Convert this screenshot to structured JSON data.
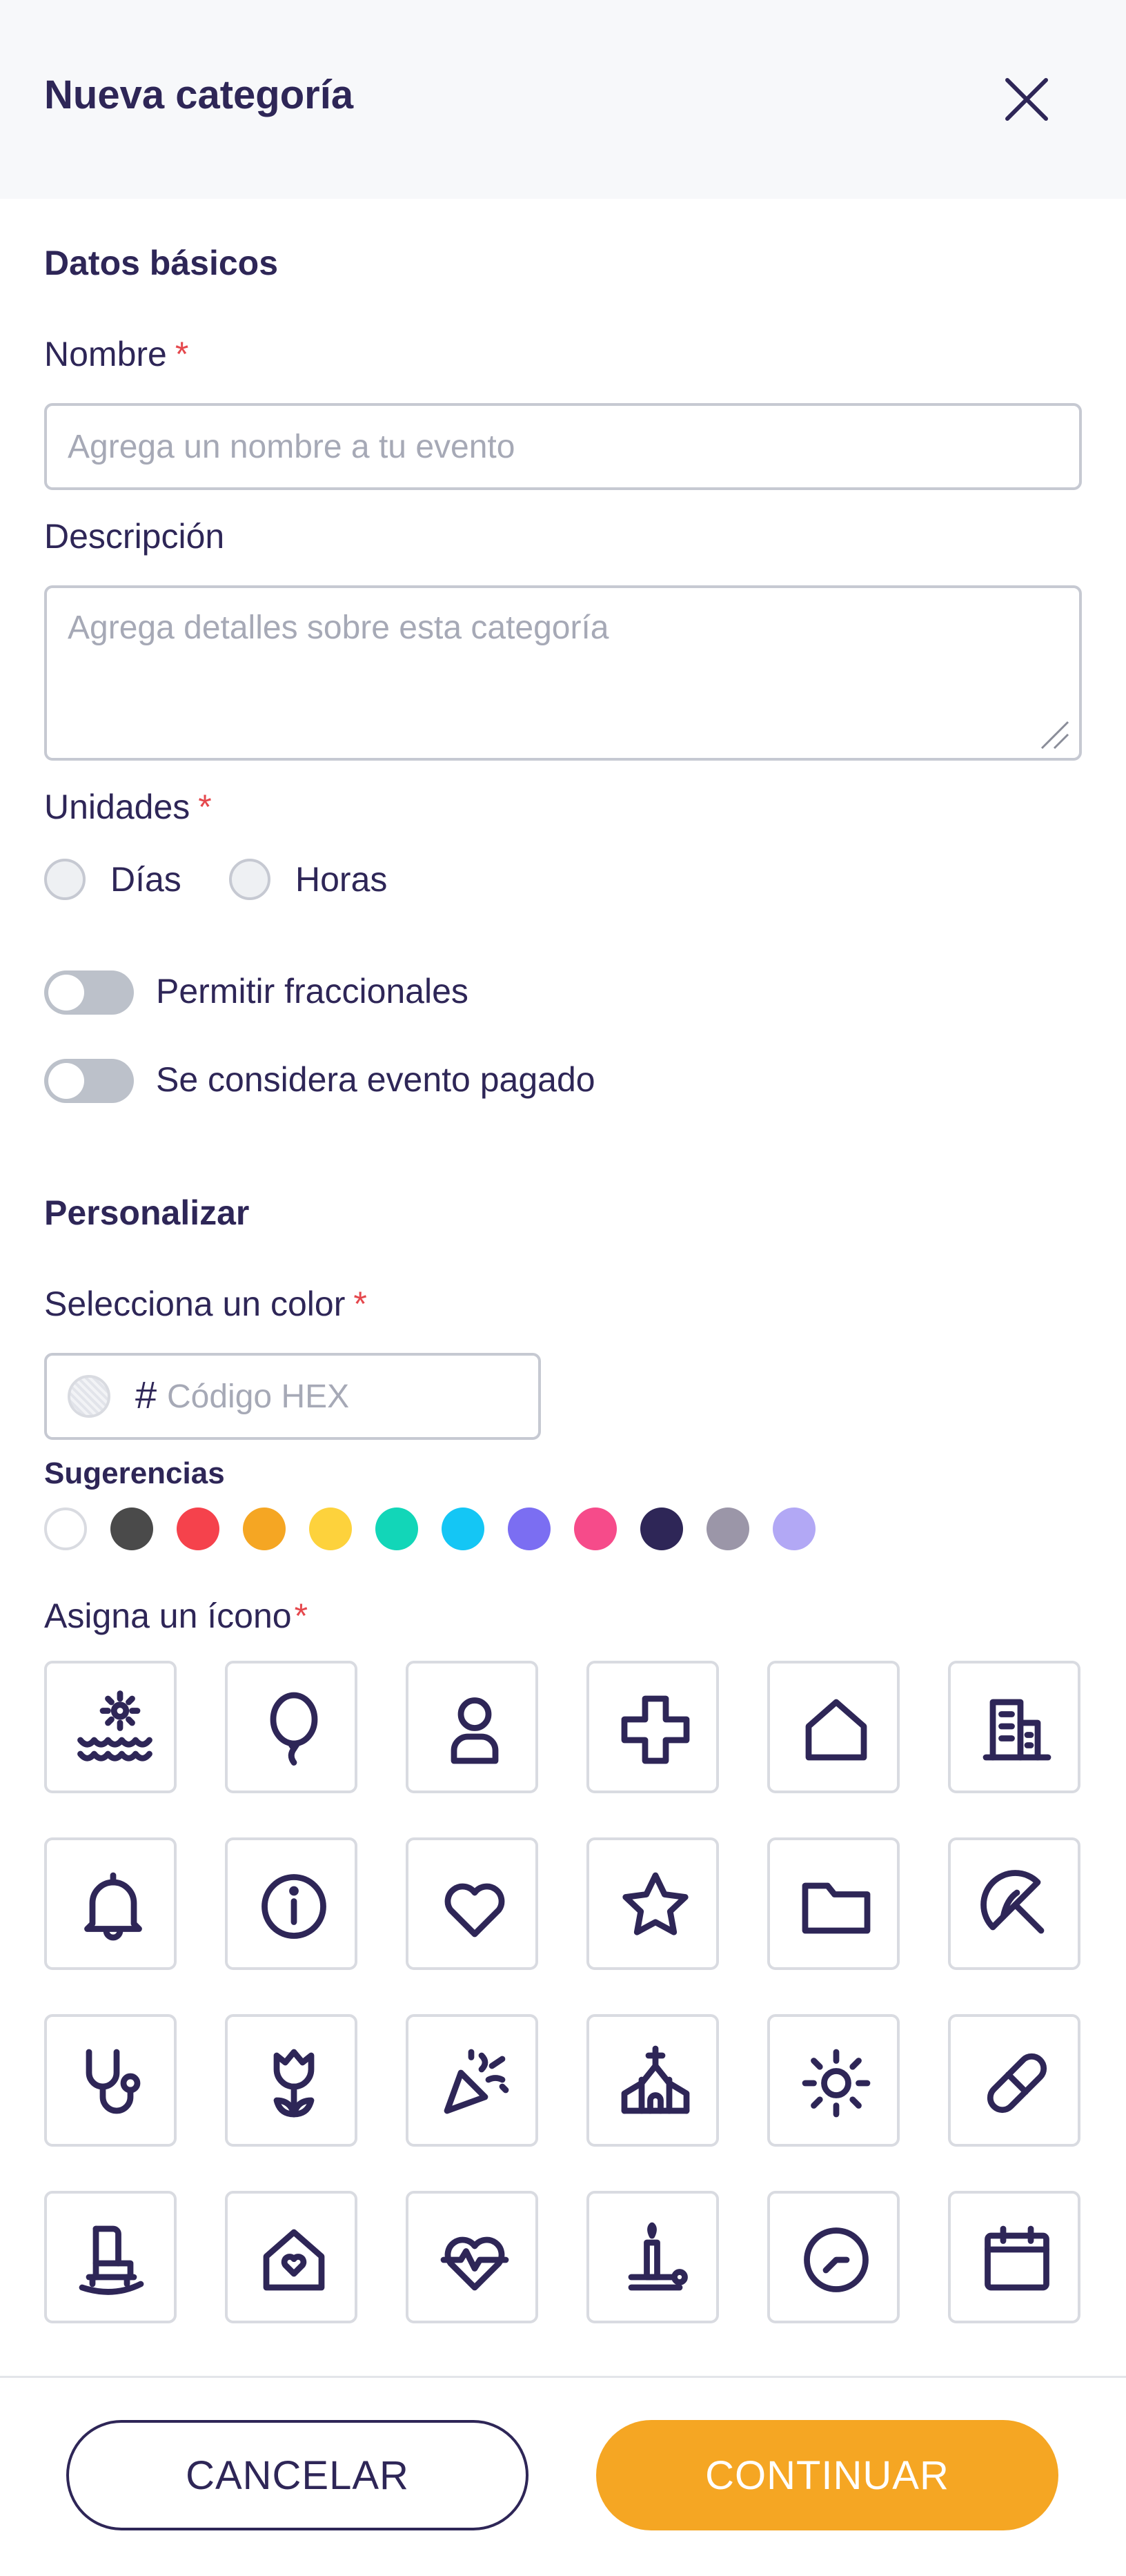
{
  "header": {
    "title": "Nueva categoría",
    "close_icon": "close-icon"
  },
  "basic": {
    "section_title": "Datos básicos",
    "name": {
      "label": "Nombre",
      "required_mark": "*",
      "placeholder": "Agrega un nombre a tu evento",
      "value": ""
    },
    "description": {
      "label": "Descripción",
      "placeholder": "Agrega detalles sobre esta categoría",
      "value": ""
    },
    "units": {
      "label": "Unidades",
      "required_mark": "*",
      "options": [
        {
          "label": "Días",
          "selected": false
        },
        {
          "label": "Horas",
          "selected": false
        }
      ]
    },
    "toggles": [
      {
        "label": "Permitir fraccionales",
        "on": false
      },
      {
        "label": "Se considera evento pagado",
        "on": false
      }
    ]
  },
  "customize": {
    "section_title": "Personalizar",
    "color": {
      "label": "Selecciona un color",
      "required_mark": "*",
      "hash": "#",
      "placeholder": "Código HEX",
      "value": ""
    },
    "suggestions": {
      "label": "Sugerencias",
      "colors": [
        "#ffffff",
        "#4a4a4a",
        "#f5424c",
        "#f5a623",
        "#fdd23c",
        "#12d6b8",
        "#14c6f5",
        "#7b6ef2",
        "#f64b8a",
        "#2e2657",
        "#9b96a8",
        "#b2a8f5"
      ]
    },
    "icon_picker": {
      "label": "Asigna un ícono",
      "required_mark": "*",
      "icons": [
        "sunrise-water-icon",
        "balloon-icon",
        "person-icon",
        "medical-cross-icon",
        "house-icon",
        "building-icon",
        "bell-icon",
        "info-icon",
        "heart-icon",
        "star-icon",
        "folder-icon",
        "umbrella-icon",
        "stethoscope-icon",
        "tulip-icon",
        "party-popper-icon",
        "church-icon",
        "sun-icon",
        "pill-icon",
        "rocking-chair-icon",
        "home-heart-icon",
        "heartbeat-icon",
        "candle-icon",
        "clock-icon",
        "calendar-icon"
      ]
    }
  },
  "footer": {
    "cancel_label": "CANCELAR",
    "continue_label": "CONTINUAR"
  },
  "colors": {
    "primary_text": "#2e2657",
    "accent": "#f5a623",
    "required": "#e5484d"
  }
}
